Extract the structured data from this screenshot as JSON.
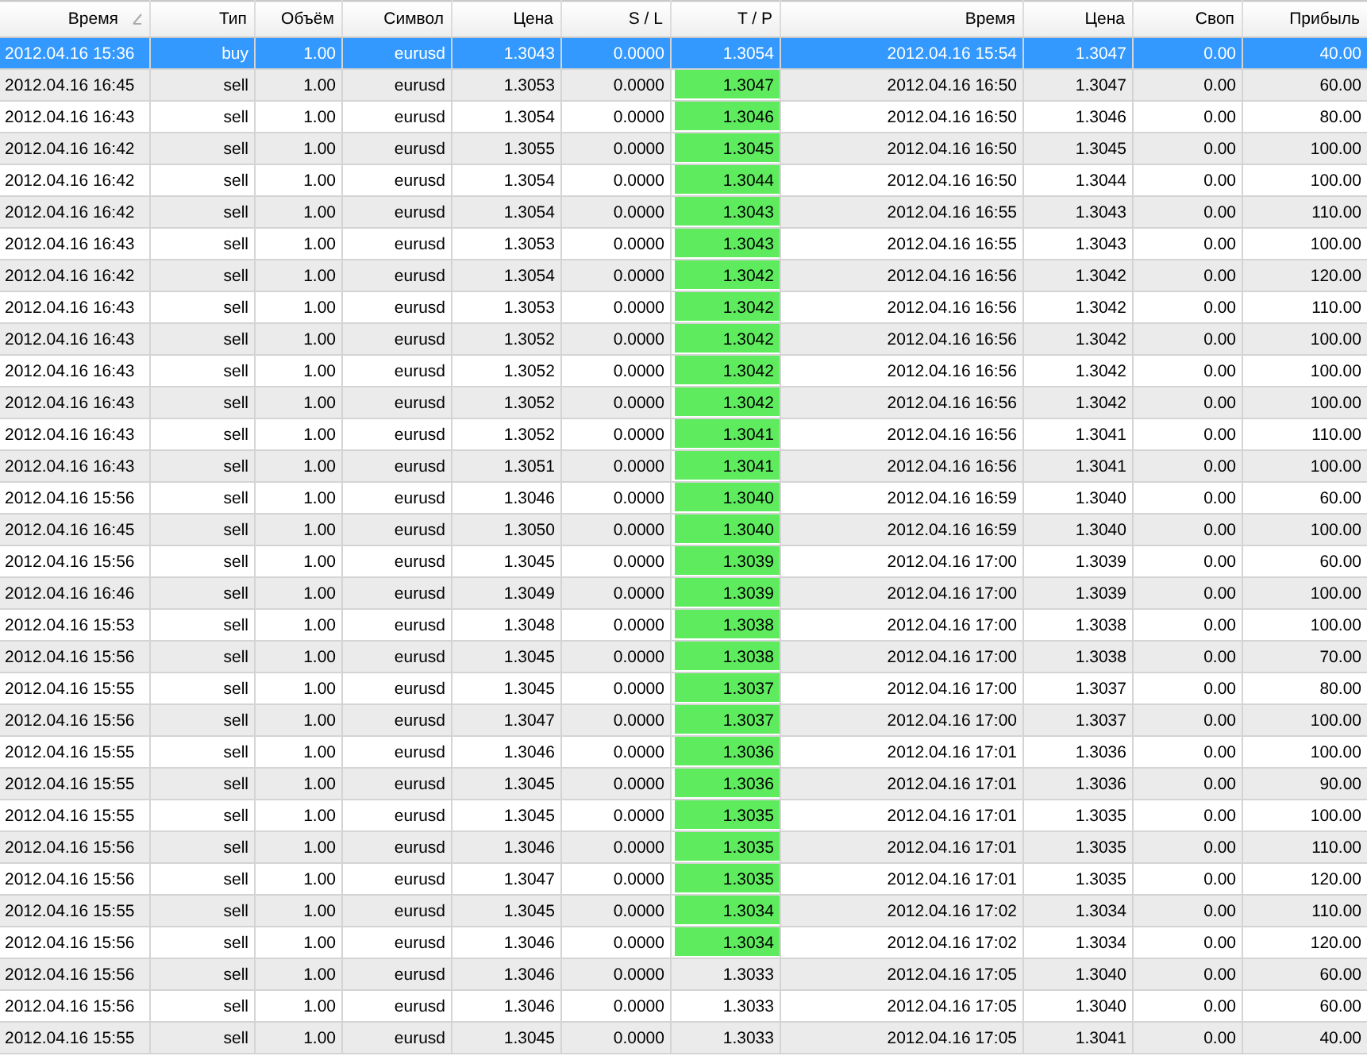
{
  "table": {
    "columns": [
      {
        "label": "Время",
        "sorted": true
      },
      {
        "label": "Тип",
        "sorted": false
      },
      {
        "label": "Объём",
        "sorted": false
      },
      {
        "label": "Символ",
        "sorted": false
      },
      {
        "label": "Цена",
        "sorted": false
      },
      {
        "label": "S / L",
        "sorted": false
      },
      {
        "label": "T / P",
        "sorted": false
      },
      {
        "label": "Время",
        "sorted": false
      },
      {
        "label": "Цена",
        "sorted": false
      },
      {
        "label": "Своп",
        "sorted": false
      },
      {
        "label": "Прибыль",
        "sorted": false
      }
    ],
    "rows": [
      {
        "selected": true,
        "tp_hit": false,
        "cells": [
          "2012.04.16 15:36",
          "buy",
          "1.00",
          "eurusd",
          "1.3043",
          "0.0000",
          "1.3054",
          "2012.04.16 15:54",
          "1.3047",
          "0.00",
          "40.00"
        ]
      },
      {
        "selected": false,
        "tp_hit": true,
        "cells": [
          "2012.04.16 16:45",
          "sell",
          "1.00",
          "eurusd",
          "1.3053",
          "0.0000",
          "1.3047",
          "2012.04.16 16:50",
          "1.3047",
          "0.00",
          "60.00"
        ]
      },
      {
        "selected": false,
        "tp_hit": true,
        "cells": [
          "2012.04.16 16:43",
          "sell",
          "1.00",
          "eurusd",
          "1.3054",
          "0.0000",
          "1.3046",
          "2012.04.16 16:50",
          "1.3046",
          "0.00",
          "80.00"
        ]
      },
      {
        "selected": false,
        "tp_hit": true,
        "cells": [
          "2012.04.16 16:42",
          "sell",
          "1.00",
          "eurusd",
          "1.3055",
          "0.0000",
          "1.3045",
          "2012.04.16 16:50",
          "1.3045",
          "0.00",
          "100.00"
        ]
      },
      {
        "selected": false,
        "tp_hit": true,
        "cells": [
          "2012.04.16 16:42",
          "sell",
          "1.00",
          "eurusd",
          "1.3054",
          "0.0000",
          "1.3044",
          "2012.04.16 16:50",
          "1.3044",
          "0.00",
          "100.00"
        ]
      },
      {
        "selected": false,
        "tp_hit": true,
        "cells": [
          "2012.04.16 16:42",
          "sell",
          "1.00",
          "eurusd",
          "1.3054",
          "0.0000",
          "1.3043",
          "2012.04.16 16:55",
          "1.3043",
          "0.00",
          "110.00"
        ]
      },
      {
        "selected": false,
        "tp_hit": true,
        "cells": [
          "2012.04.16 16:43",
          "sell",
          "1.00",
          "eurusd",
          "1.3053",
          "0.0000",
          "1.3043",
          "2012.04.16 16:55",
          "1.3043",
          "0.00",
          "100.00"
        ]
      },
      {
        "selected": false,
        "tp_hit": true,
        "cells": [
          "2012.04.16 16:42",
          "sell",
          "1.00",
          "eurusd",
          "1.3054",
          "0.0000",
          "1.3042",
          "2012.04.16 16:56",
          "1.3042",
          "0.00",
          "120.00"
        ]
      },
      {
        "selected": false,
        "tp_hit": true,
        "cells": [
          "2012.04.16 16:43",
          "sell",
          "1.00",
          "eurusd",
          "1.3053",
          "0.0000",
          "1.3042",
          "2012.04.16 16:56",
          "1.3042",
          "0.00",
          "110.00"
        ]
      },
      {
        "selected": false,
        "tp_hit": true,
        "cells": [
          "2012.04.16 16:43",
          "sell",
          "1.00",
          "eurusd",
          "1.3052",
          "0.0000",
          "1.3042",
          "2012.04.16 16:56",
          "1.3042",
          "0.00",
          "100.00"
        ]
      },
      {
        "selected": false,
        "tp_hit": true,
        "cells": [
          "2012.04.16 16:43",
          "sell",
          "1.00",
          "eurusd",
          "1.3052",
          "0.0000",
          "1.3042",
          "2012.04.16 16:56",
          "1.3042",
          "0.00",
          "100.00"
        ]
      },
      {
        "selected": false,
        "tp_hit": true,
        "cells": [
          "2012.04.16 16:43",
          "sell",
          "1.00",
          "eurusd",
          "1.3052",
          "0.0000",
          "1.3042",
          "2012.04.16 16:56",
          "1.3042",
          "0.00",
          "100.00"
        ]
      },
      {
        "selected": false,
        "tp_hit": true,
        "cells": [
          "2012.04.16 16:43",
          "sell",
          "1.00",
          "eurusd",
          "1.3052",
          "0.0000",
          "1.3041",
          "2012.04.16 16:56",
          "1.3041",
          "0.00",
          "110.00"
        ]
      },
      {
        "selected": false,
        "tp_hit": true,
        "cells": [
          "2012.04.16 16:43",
          "sell",
          "1.00",
          "eurusd",
          "1.3051",
          "0.0000",
          "1.3041",
          "2012.04.16 16:56",
          "1.3041",
          "0.00",
          "100.00"
        ]
      },
      {
        "selected": false,
        "tp_hit": true,
        "cells": [
          "2012.04.16 15:56",
          "sell",
          "1.00",
          "eurusd",
          "1.3046",
          "0.0000",
          "1.3040",
          "2012.04.16 16:59",
          "1.3040",
          "0.00",
          "60.00"
        ]
      },
      {
        "selected": false,
        "tp_hit": true,
        "cells": [
          "2012.04.16 16:45",
          "sell",
          "1.00",
          "eurusd",
          "1.3050",
          "0.0000",
          "1.3040",
          "2012.04.16 16:59",
          "1.3040",
          "0.00",
          "100.00"
        ]
      },
      {
        "selected": false,
        "tp_hit": true,
        "cells": [
          "2012.04.16 15:56",
          "sell",
          "1.00",
          "eurusd",
          "1.3045",
          "0.0000",
          "1.3039",
          "2012.04.16 17:00",
          "1.3039",
          "0.00",
          "60.00"
        ]
      },
      {
        "selected": false,
        "tp_hit": true,
        "cells": [
          "2012.04.16 16:46",
          "sell",
          "1.00",
          "eurusd",
          "1.3049",
          "0.0000",
          "1.3039",
          "2012.04.16 17:00",
          "1.3039",
          "0.00",
          "100.00"
        ]
      },
      {
        "selected": false,
        "tp_hit": true,
        "cells": [
          "2012.04.16 15:53",
          "sell",
          "1.00",
          "eurusd",
          "1.3048",
          "0.0000",
          "1.3038",
          "2012.04.16 17:00",
          "1.3038",
          "0.00",
          "100.00"
        ]
      },
      {
        "selected": false,
        "tp_hit": true,
        "cells": [
          "2012.04.16 15:56",
          "sell",
          "1.00",
          "eurusd",
          "1.3045",
          "0.0000",
          "1.3038",
          "2012.04.16 17:00",
          "1.3038",
          "0.00",
          "70.00"
        ]
      },
      {
        "selected": false,
        "tp_hit": true,
        "cells": [
          "2012.04.16 15:55",
          "sell",
          "1.00",
          "eurusd",
          "1.3045",
          "0.0000",
          "1.3037",
          "2012.04.16 17:00",
          "1.3037",
          "0.00",
          "80.00"
        ]
      },
      {
        "selected": false,
        "tp_hit": true,
        "cells": [
          "2012.04.16 15:56",
          "sell",
          "1.00",
          "eurusd",
          "1.3047",
          "0.0000",
          "1.3037",
          "2012.04.16 17:00",
          "1.3037",
          "0.00",
          "100.00"
        ]
      },
      {
        "selected": false,
        "tp_hit": true,
        "cells": [
          "2012.04.16 15:55",
          "sell",
          "1.00",
          "eurusd",
          "1.3046",
          "0.0000",
          "1.3036",
          "2012.04.16 17:01",
          "1.3036",
          "0.00",
          "100.00"
        ]
      },
      {
        "selected": false,
        "tp_hit": true,
        "cells": [
          "2012.04.16 15:55",
          "sell",
          "1.00",
          "eurusd",
          "1.3045",
          "0.0000",
          "1.3036",
          "2012.04.16 17:01",
          "1.3036",
          "0.00",
          "90.00"
        ]
      },
      {
        "selected": false,
        "tp_hit": true,
        "cells": [
          "2012.04.16 15:55",
          "sell",
          "1.00",
          "eurusd",
          "1.3045",
          "0.0000",
          "1.3035",
          "2012.04.16 17:01",
          "1.3035",
          "0.00",
          "100.00"
        ]
      },
      {
        "selected": false,
        "tp_hit": true,
        "cells": [
          "2012.04.16 15:56",
          "sell",
          "1.00",
          "eurusd",
          "1.3046",
          "0.0000",
          "1.3035",
          "2012.04.16 17:01",
          "1.3035",
          "0.00",
          "110.00"
        ]
      },
      {
        "selected": false,
        "tp_hit": true,
        "cells": [
          "2012.04.16 15:56",
          "sell",
          "1.00",
          "eurusd",
          "1.3047",
          "0.0000",
          "1.3035",
          "2012.04.16 17:01",
          "1.3035",
          "0.00",
          "120.00"
        ]
      },
      {
        "selected": false,
        "tp_hit": true,
        "cells": [
          "2012.04.16 15:55",
          "sell",
          "1.00",
          "eurusd",
          "1.3045",
          "0.0000",
          "1.3034",
          "2012.04.16 17:02",
          "1.3034",
          "0.00",
          "110.00"
        ]
      },
      {
        "selected": false,
        "tp_hit": true,
        "cells": [
          "2012.04.16 15:56",
          "sell",
          "1.00",
          "eurusd",
          "1.3046",
          "0.0000",
          "1.3034",
          "2012.04.16 17:02",
          "1.3034",
          "0.00",
          "120.00"
        ]
      },
      {
        "selected": false,
        "tp_hit": false,
        "cells": [
          "2012.04.16 15:56",
          "sell",
          "1.00",
          "eurusd",
          "1.3046",
          "0.0000",
          "1.3033",
          "2012.04.16 17:05",
          "1.3040",
          "0.00",
          "60.00"
        ]
      },
      {
        "selected": false,
        "tp_hit": false,
        "cells": [
          "2012.04.16 15:56",
          "sell",
          "1.00",
          "eurusd",
          "1.3046",
          "0.0000",
          "1.3033",
          "2012.04.16 17:05",
          "1.3040",
          "0.00",
          "60.00"
        ]
      },
      {
        "selected": false,
        "tp_hit": false,
        "cells": [
          "2012.04.16 15:55",
          "sell",
          "1.00",
          "eurusd",
          "1.3045",
          "0.0000",
          "1.3033",
          "2012.04.16 17:05",
          "1.3041",
          "0.00",
          "40.00"
        ]
      }
    ]
  }
}
